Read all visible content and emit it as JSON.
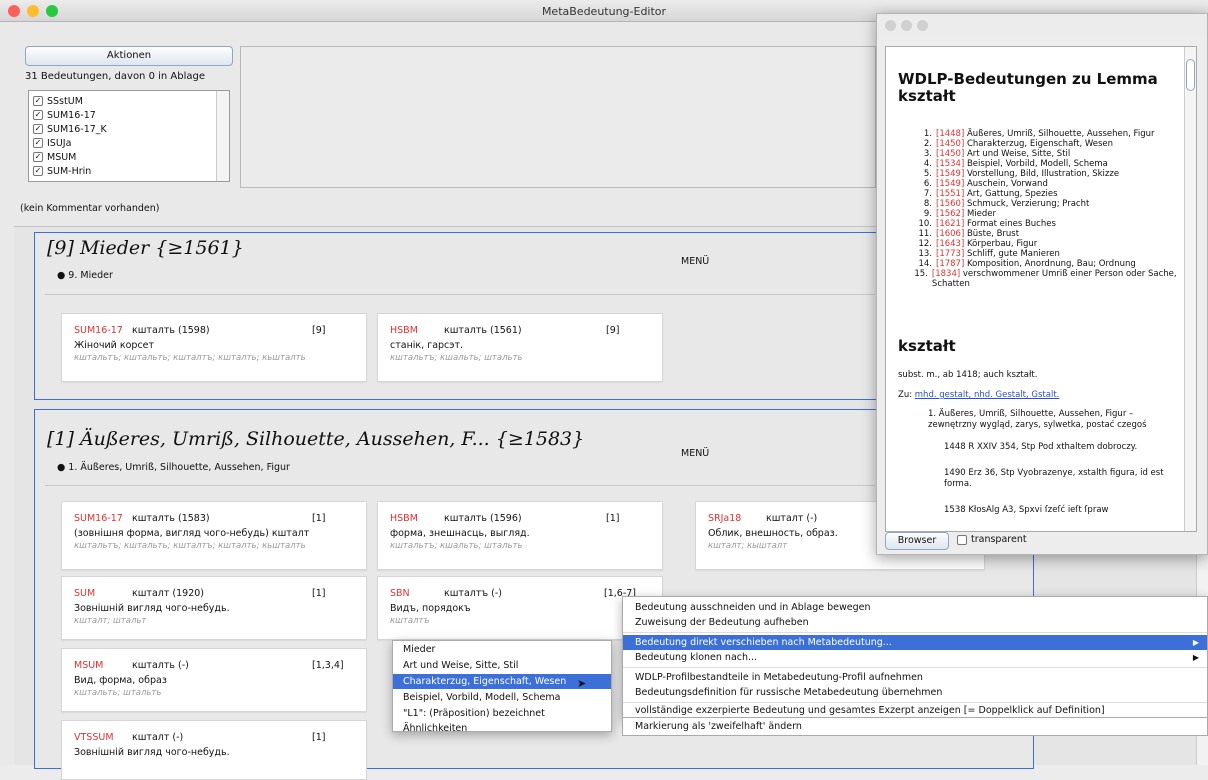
{
  "window": {
    "title": "MetaBedeutung-Editor",
    "traffic": [
      "#fe5f57",
      "#febc2e",
      "#28c840"
    ]
  },
  "toolbar": {
    "aktionen_label": "Aktionen",
    "count_text": "31 Bedeutungen, davon 0 in Ablage"
  },
  "filters": [
    {
      "label": "SSstUM",
      "checked": true
    },
    {
      "label": "SUM16-17",
      "checked": true
    },
    {
      "label": "SUM16-17_K",
      "checked": true
    },
    {
      "label": "ISUJa",
      "checked": true
    },
    {
      "label": "MSUM",
      "checked": true
    },
    {
      "label": "SUM-Hrin",
      "checked": true
    }
  ],
  "comment": "(kein Kommentar vorhanden)",
  "panels": [
    {
      "title": "[9] Mieder {≥1561}",
      "bullet": "● 9. Mieder",
      "menu": "MENÜ",
      "cards": [
        {
          "src": "SUM16-17",
          "lemma": "кшталть (1598)",
          "num": "[9]",
          "def": "Жіночий корсет",
          "forms": "кштальтъ; кштальть; кшталтъ; кшталть; кьшталть"
        },
        {
          "src": "HSBM",
          "lemma": "кшталть (1561)",
          "num": "[9]",
          "def": "станік, гарсэт.",
          "forms": "кштальтъ; кшальть; штальть"
        }
      ]
    },
    {
      "title": "[1] Äußeres, Umriß, Silhouette, Aussehen, F... {≥1583}",
      "bullet": "● 1. Äußeres, Umriß, Silhouette, Aussehen, Figur",
      "menu": "MENÜ",
      "cards": [
        {
          "src": "SUM16-17",
          "lemma": "кшталть (1583)",
          "num": "[1]",
          "def": "(зовнішня форма, вигляд чого-небудь) кшталт",
          "forms": "кштальтъ; кштальть; кшталтъ; кшталть; кьшталть"
        },
        {
          "src": "HSBM",
          "lemma": "кшталть (1596)",
          "num": "[1]",
          "def": "форма, знешнасць, выгляд.",
          "forms": "кштальтъ; кшальть; штальть"
        },
        {
          "src": "SRJa18",
          "lemma": "кшталт (-)",
          "num": "",
          "def": "Облик, внешность, образ.",
          "forms": "кшталт; кышталт"
        },
        {
          "src": "SUM",
          "lemma": "кшталт (1920)",
          "num": "[1]",
          "def": "Зовнішній вигляд чого-небудь.",
          "forms": "кшталт; штальт"
        },
        {
          "src": "SBN",
          "lemma": "кшталтъ (-)",
          "num": "[1,6-7]",
          "def": "Видъ, порядокъ",
          "forms": "кшталтъ"
        },
        {
          "src": "MSUM",
          "lemma": "кшталть (-)",
          "num": "[1,3,4]",
          "def": "Вид, форма, образ",
          "forms": "кштальть; штальть"
        },
        {
          "src": "VTSSUM",
          "lemma": "кшталт (-)",
          "num": "[1]",
          "def": "Зовнішній вигляд чого-небудь.",
          "forms": ""
        }
      ]
    }
  ],
  "popup": {
    "heading": "WDLP-Bedeutungen zu Lemma",
    "lemma": "kształt",
    "senses": [
      {
        "n": "1.",
        "year": "[1448]",
        "text": "Äußeres, Umriß, Silhouette, Aussehen, Figur"
      },
      {
        "n": "2.",
        "year": "[1450]",
        "text": "Charakterzug, Eigenschaft, Wesen"
      },
      {
        "n": "3.",
        "year": "[1450]",
        "text": "Art und Weise, Sitte, Stil"
      },
      {
        "n": "4.",
        "year": "[1534]",
        "text": "Beispiel, Vorbild, Modell, Schema"
      },
      {
        "n": "5.",
        "year": "[1549]",
        "text": "Vorstellung, Bild, Illustration, Skizze"
      },
      {
        "n": "6.",
        "year": "[1549]",
        "text": "Auschein, Vorwand"
      },
      {
        "n": "7.",
        "year": "[1551]",
        "text": "Art, Gattung, Spezies"
      },
      {
        "n": "8.",
        "year": "[1560]",
        "text": "Schmuck, Verzierung; Pracht"
      },
      {
        "n": "9.",
        "year": "[1562]",
        "text": "Mieder"
      },
      {
        "n": "10.",
        "year": "[1621]",
        "text": "Format eines Buches"
      },
      {
        "n": "11.",
        "year": "[1606]",
        "text": "Büste, Brust"
      },
      {
        "n": "12.",
        "year": "[1643]",
        "text": "Körperbau, Figur"
      },
      {
        "n": "13.",
        "year": "[1773]",
        "text": "Schliff, gute Manieren"
      },
      {
        "n": "14.",
        "year": "[1787]",
        "text": "Komposition, Anordnung, Bau; Ordnung"
      },
      {
        "n": "15.",
        "year": "[1834]",
        "text": "verschwommener Umriß einer Person oder Sache, Schatten"
      }
    ],
    "entry_head": "kształt",
    "entry_gram": "subst. m., ab 1418; auch kształt.",
    "zu_label": "Zu:",
    "zu_link": "mhd. gestalt, nhd. Gestalt, Gstalt.",
    "entry_sense": "1. Äußeres, Umriß, Silhouette, Aussehen, Figur – zewnętrzny wygląd, zarys, sylwetka, postać czegoś",
    "cit1": "1448 R XXIV 354, Stp Pod xthaltem dobroczy.",
    "cit2": "1490 Erz 36, Stp Vyobrazenye, xstalth figura, id est forma.",
    "cit3": "1538 KłosAlg A3, Spxvi ſzeſć ieſt ſpraw",
    "browser_label": "Browser",
    "transparent_label": "transparent"
  },
  "context_menu": {
    "items": [
      "Bedeutung ausschneiden und in Ablage bewegen",
      "Zuweisung der Bedeutung aufheben",
      "Bedeutung direkt verschieben nach Metabedeutung...",
      "Bedeutung klonen nach...",
      "WDLP-Profilbestandteile in Metabedeutung-Profil aufnehmen",
      "Bedeutungsdefinition für russische Metabedeutung übernehmen",
      "vollständige exzerpierte Bedeutung und gesamtes Exzerpt anzeigen [= Doppelklick auf Definition]",
      "Markierung als 'zweifelhaft' ändern"
    ],
    "submenu": [
      "Mieder",
      "Art und Weise, Sitte, Stil",
      "Charakterzug, Eigenschaft, Wesen",
      "Beispiel, Vorbild, Modell, Schema",
      "\"L1\": (Präposition) bezeichnet Ähnlichkeiten"
    ]
  }
}
